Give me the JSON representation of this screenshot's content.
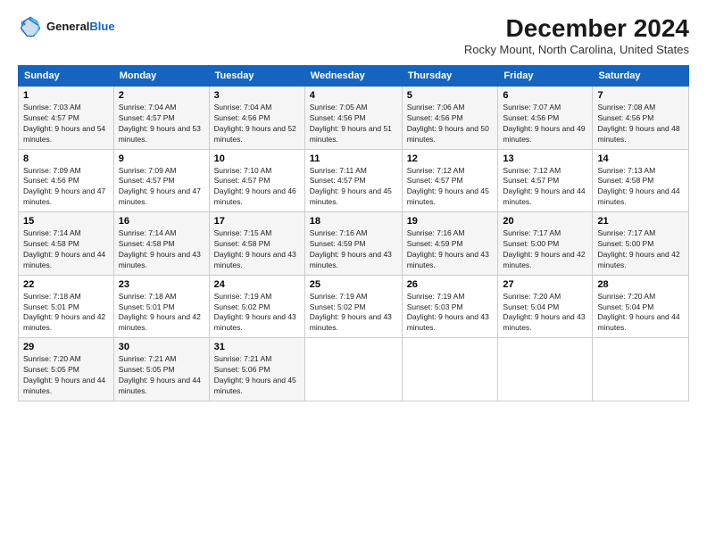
{
  "header": {
    "logo_line1": "General",
    "logo_line2": "Blue",
    "main_title": "December 2024",
    "subtitle": "Rocky Mount, North Carolina, United States"
  },
  "days_of_week": [
    "Sunday",
    "Monday",
    "Tuesday",
    "Wednesday",
    "Thursday",
    "Friday",
    "Saturday"
  ],
  "weeks": [
    [
      {
        "day": "1",
        "sunrise": "Sunrise: 7:03 AM",
        "sunset": "Sunset: 4:57 PM",
        "daylight": "Daylight: 9 hours and 54 minutes."
      },
      {
        "day": "2",
        "sunrise": "Sunrise: 7:04 AM",
        "sunset": "Sunset: 4:57 PM",
        "daylight": "Daylight: 9 hours and 53 minutes."
      },
      {
        "day": "3",
        "sunrise": "Sunrise: 7:04 AM",
        "sunset": "Sunset: 4:56 PM",
        "daylight": "Daylight: 9 hours and 52 minutes."
      },
      {
        "day": "4",
        "sunrise": "Sunrise: 7:05 AM",
        "sunset": "Sunset: 4:56 PM",
        "daylight": "Daylight: 9 hours and 51 minutes."
      },
      {
        "day": "5",
        "sunrise": "Sunrise: 7:06 AM",
        "sunset": "Sunset: 4:56 PM",
        "daylight": "Daylight: 9 hours and 50 minutes."
      },
      {
        "day": "6",
        "sunrise": "Sunrise: 7:07 AM",
        "sunset": "Sunset: 4:56 PM",
        "daylight": "Daylight: 9 hours and 49 minutes."
      },
      {
        "day": "7",
        "sunrise": "Sunrise: 7:08 AM",
        "sunset": "Sunset: 4:56 PM",
        "daylight": "Daylight: 9 hours and 48 minutes."
      }
    ],
    [
      {
        "day": "8",
        "sunrise": "Sunrise: 7:09 AM",
        "sunset": "Sunset: 4:56 PM",
        "daylight": "Daylight: 9 hours and 47 minutes."
      },
      {
        "day": "9",
        "sunrise": "Sunrise: 7:09 AM",
        "sunset": "Sunset: 4:57 PM",
        "daylight": "Daylight: 9 hours and 47 minutes."
      },
      {
        "day": "10",
        "sunrise": "Sunrise: 7:10 AM",
        "sunset": "Sunset: 4:57 PM",
        "daylight": "Daylight: 9 hours and 46 minutes."
      },
      {
        "day": "11",
        "sunrise": "Sunrise: 7:11 AM",
        "sunset": "Sunset: 4:57 PM",
        "daylight": "Daylight: 9 hours and 45 minutes."
      },
      {
        "day": "12",
        "sunrise": "Sunrise: 7:12 AM",
        "sunset": "Sunset: 4:57 PM",
        "daylight": "Daylight: 9 hours and 45 minutes."
      },
      {
        "day": "13",
        "sunrise": "Sunrise: 7:12 AM",
        "sunset": "Sunset: 4:57 PM",
        "daylight": "Daylight: 9 hours and 44 minutes."
      },
      {
        "day": "14",
        "sunrise": "Sunrise: 7:13 AM",
        "sunset": "Sunset: 4:58 PM",
        "daylight": "Daylight: 9 hours and 44 minutes."
      }
    ],
    [
      {
        "day": "15",
        "sunrise": "Sunrise: 7:14 AM",
        "sunset": "Sunset: 4:58 PM",
        "daylight": "Daylight: 9 hours and 44 minutes."
      },
      {
        "day": "16",
        "sunrise": "Sunrise: 7:14 AM",
        "sunset": "Sunset: 4:58 PM",
        "daylight": "Daylight: 9 hours and 43 minutes."
      },
      {
        "day": "17",
        "sunrise": "Sunrise: 7:15 AM",
        "sunset": "Sunset: 4:58 PM",
        "daylight": "Daylight: 9 hours and 43 minutes."
      },
      {
        "day": "18",
        "sunrise": "Sunrise: 7:16 AM",
        "sunset": "Sunset: 4:59 PM",
        "daylight": "Daylight: 9 hours and 43 minutes."
      },
      {
        "day": "19",
        "sunrise": "Sunrise: 7:16 AM",
        "sunset": "Sunset: 4:59 PM",
        "daylight": "Daylight: 9 hours and 43 minutes."
      },
      {
        "day": "20",
        "sunrise": "Sunrise: 7:17 AM",
        "sunset": "Sunset: 5:00 PM",
        "daylight": "Daylight: 9 hours and 42 minutes."
      },
      {
        "day": "21",
        "sunrise": "Sunrise: 7:17 AM",
        "sunset": "Sunset: 5:00 PM",
        "daylight": "Daylight: 9 hours and 42 minutes."
      }
    ],
    [
      {
        "day": "22",
        "sunrise": "Sunrise: 7:18 AM",
        "sunset": "Sunset: 5:01 PM",
        "daylight": "Daylight: 9 hours and 42 minutes."
      },
      {
        "day": "23",
        "sunrise": "Sunrise: 7:18 AM",
        "sunset": "Sunset: 5:01 PM",
        "daylight": "Daylight: 9 hours and 42 minutes."
      },
      {
        "day": "24",
        "sunrise": "Sunrise: 7:19 AM",
        "sunset": "Sunset: 5:02 PM",
        "daylight": "Daylight: 9 hours and 43 minutes."
      },
      {
        "day": "25",
        "sunrise": "Sunrise: 7:19 AM",
        "sunset": "Sunset: 5:02 PM",
        "daylight": "Daylight: 9 hours and 43 minutes."
      },
      {
        "day": "26",
        "sunrise": "Sunrise: 7:19 AM",
        "sunset": "Sunset: 5:03 PM",
        "daylight": "Daylight: 9 hours and 43 minutes."
      },
      {
        "day": "27",
        "sunrise": "Sunrise: 7:20 AM",
        "sunset": "Sunset: 5:04 PM",
        "daylight": "Daylight: 9 hours and 43 minutes."
      },
      {
        "day": "28",
        "sunrise": "Sunrise: 7:20 AM",
        "sunset": "Sunset: 5:04 PM",
        "daylight": "Daylight: 9 hours and 44 minutes."
      }
    ],
    [
      {
        "day": "29",
        "sunrise": "Sunrise: 7:20 AM",
        "sunset": "Sunset: 5:05 PM",
        "daylight": "Daylight: 9 hours and 44 minutes."
      },
      {
        "day": "30",
        "sunrise": "Sunrise: 7:21 AM",
        "sunset": "Sunset: 5:05 PM",
        "daylight": "Daylight: 9 hours and 44 minutes."
      },
      {
        "day": "31",
        "sunrise": "Sunrise: 7:21 AM",
        "sunset": "Sunset: 5:06 PM",
        "daylight": "Daylight: 9 hours and 45 minutes."
      },
      null,
      null,
      null,
      null
    ]
  ]
}
